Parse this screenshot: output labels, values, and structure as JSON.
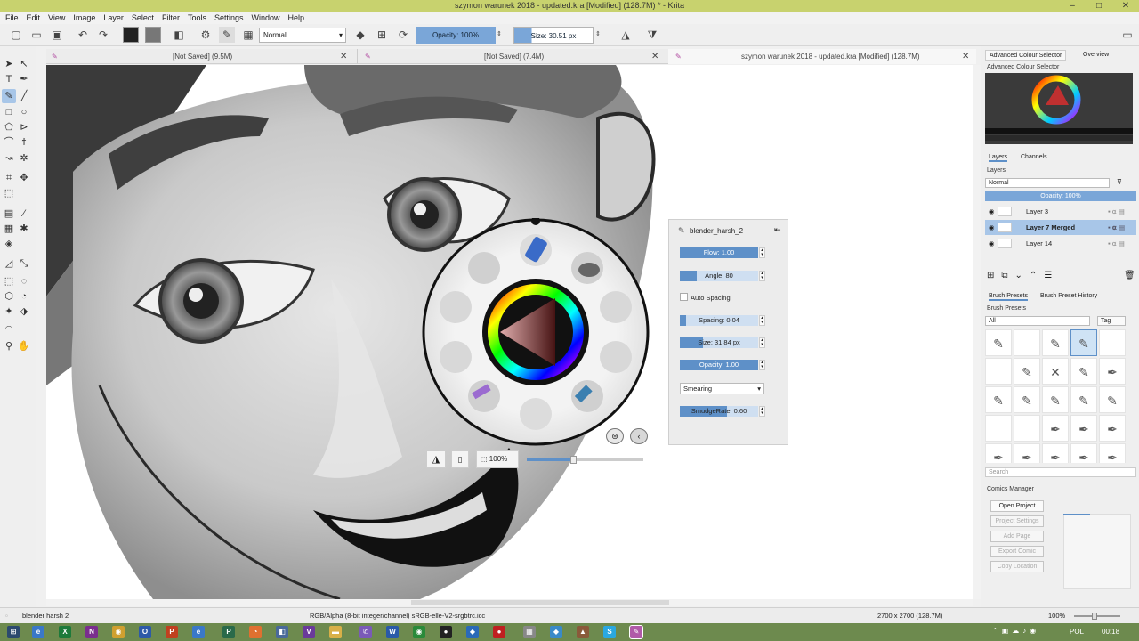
{
  "window": {
    "title": "szymon warunek 2018 - updated.kra [Modified]  (128.7M) * - Krita"
  },
  "menu": [
    "File",
    "Edit",
    "View",
    "Image",
    "Layer",
    "Select",
    "Filter",
    "Tools",
    "Settings",
    "Window",
    "Help"
  ],
  "toolbar": {
    "blend_mode": "Normal",
    "opacity_label": "Opacity: 100%",
    "opacity_value": 100,
    "size_label": "Size:  30.51 px"
  },
  "tabs": [
    {
      "label": "[Not Saved]  (9.5M)"
    },
    {
      "label": "[Not Saved]  (7.4M)"
    },
    {
      "label": "szymon warunek 2018 - updated.kra [Modified]  (128.7M)"
    }
  ],
  "popup": {
    "zoom_label": "100%",
    "zoom_value": 0.4
  },
  "brush_editor": {
    "preset_name": "blender_harsh_2",
    "flow": {
      "label": "Flow: 1.00",
      "value": 1.0
    },
    "angle": {
      "label": "Angle: 80",
      "value": 0.22
    },
    "auto_spacing": "Auto Spacing",
    "spacing": {
      "label": "Spacing: 0.04",
      "value": 0.08
    },
    "size": {
      "label": "Size: 31.84 px",
      "value": 0.3
    },
    "opacity": {
      "label": "Opacity: 1.00",
      "value": 1.0
    },
    "mode": "Smearing",
    "smudge": {
      "label": "SmudgeRate: 0.60",
      "value": 0.6
    }
  },
  "docker": {
    "tabs_top": [
      "Advanced Colour Selector",
      "Overview"
    ],
    "color_selector_title": "Advanced Colour Selector",
    "layers_tabs": [
      "Layers",
      "Channels"
    ],
    "layers_title": "Layers",
    "layers_blend": "Normal",
    "layers_opacity": "Opacity:  100%",
    "layers": [
      {
        "name": "Layer 3",
        "active": false
      },
      {
        "name": "Layer 7 Merged",
        "active": true
      },
      {
        "name": "Layer 14",
        "active": false
      }
    ],
    "brush_tabs": [
      "Brush Presets",
      "Brush Preset History"
    ],
    "brush_title": "Brush Presets",
    "brush_filter": "All",
    "brush_tag": "Tag",
    "search_placeholder": "Search",
    "comics_title": "Comics Manager",
    "comics_buttons": [
      "Open Project",
      "Project Settings",
      "Add Page",
      "Export Comic",
      "Copy Location"
    ]
  },
  "status": {
    "brush": "blender harsh 2",
    "color_space": "RGB/Alpha (8-bit integer/channel)  sRGB-elle-V2-srgbtrc.icc",
    "dimensions": "2700 x 2700 (128.7M)",
    "zoom": "100%"
  },
  "taskbar": {
    "lang": "POL",
    "time": "00:18"
  },
  "colors": {
    "accent": "#5e90c8",
    "title_bar": "#c8d26e",
    "taskbar": "#6d8a4e",
    "selected_layer": "#a8c6e8"
  }
}
